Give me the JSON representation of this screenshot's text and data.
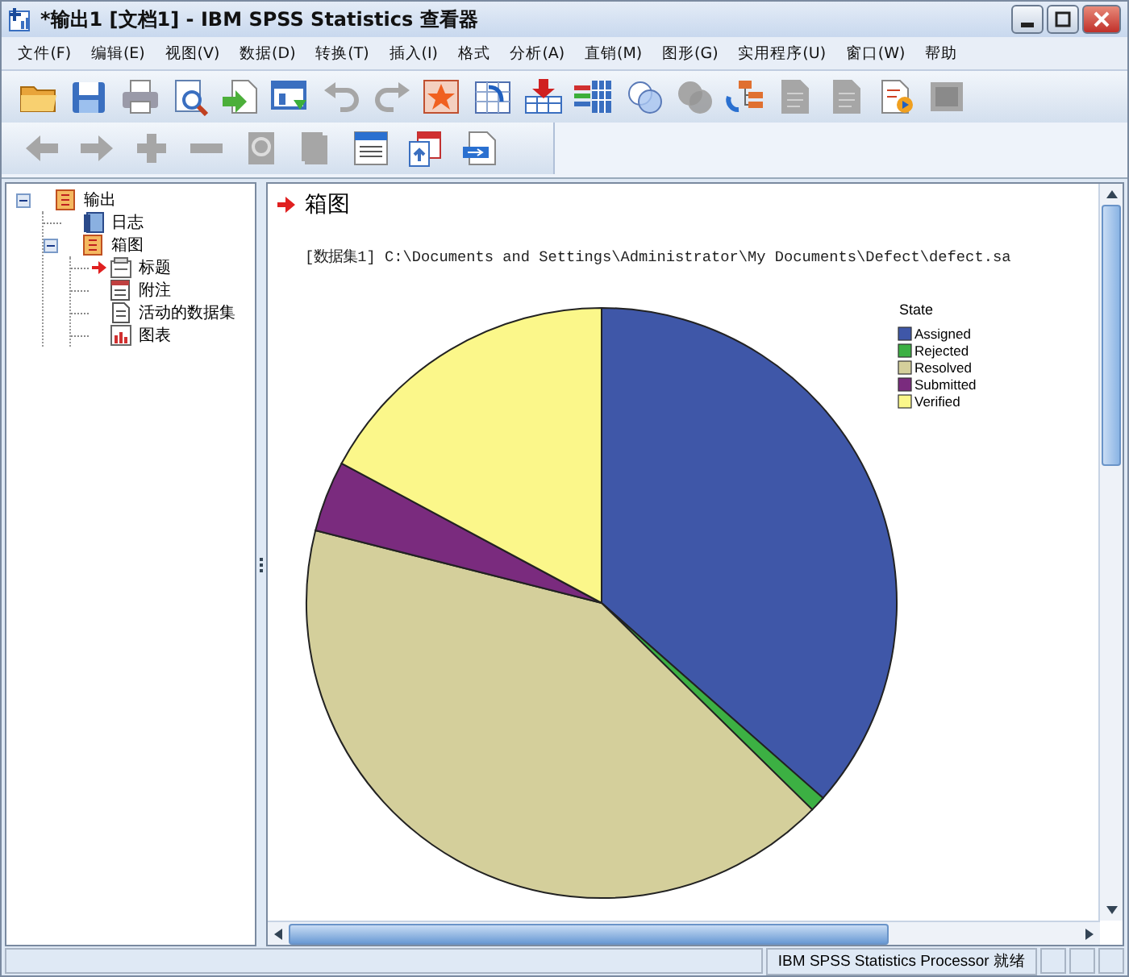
{
  "window": {
    "title": "*输出1 [文档1] - IBM SPSS Statistics 查看器"
  },
  "menu": [
    "文件(F)",
    "编辑(E)",
    "视图(V)",
    "数据(D)",
    "转换(T)",
    "插入(I)",
    "格式",
    "分析(A)",
    "直销(M)",
    "图形(G)",
    "实用程序(U)",
    "窗口(W)",
    "帮助"
  ],
  "toolbar": [
    {
      "kind": "folder",
      "disabled": false
    },
    {
      "kind": "disk",
      "disabled": false
    },
    {
      "kind": "printer",
      "disabled": false
    },
    {
      "kind": "preview",
      "disabled": false
    },
    {
      "kind": "import",
      "disabled": false
    },
    {
      "kind": "window",
      "disabled": false
    },
    {
      "kind": "undo",
      "disabled": true
    },
    {
      "kind": "redo",
      "disabled": true
    },
    {
      "kind": "star",
      "disabled": false
    },
    {
      "kind": "pivot",
      "disabled": false
    },
    {
      "kind": "insert",
      "disabled": false
    },
    {
      "kind": "bars",
      "disabled": false
    },
    {
      "kind": "circles",
      "disabled": false
    },
    {
      "kind": "circles",
      "disabled": true
    },
    {
      "kind": "tree",
      "disabled": false
    },
    {
      "kind": "page",
      "disabled": true
    },
    {
      "kind": "page",
      "disabled": true
    },
    {
      "kind": "script",
      "disabled": false
    },
    {
      "kind": "square",
      "disabled": true
    }
  ],
  "toolbar_2": [
    {
      "kind": "back",
      "disabled": true
    },
    {
      "kind": "forward",
      "disabled": true
    },
    {
      "kind": "plus",
      "disabled": true
    },
    {
      "kind": "minus",
      "disabled": true
    },
    {
      "kind": "zoom",
      "disabled": true
    },
    {
      "kind": "book",
      "disabled": true
    },
    {
      "kind": "heading",
      "disabled": false
    },
    {
      "kind": "copy",
      "disabled": false
    },
    {
      "kind": "export",
      "disabled": false
    }
  ],
  "outline": [
    {
      "label": "输出",
      "kind": "book",
      "expanded": true,
      "selected": false,
      "children": [
        {
          "label": "日志",
          "kind": "log",
          "selected": false
        },
        {
          "label": "箱图",
          "kind": "book",
          "expanded": true,
          "selected": false,
          "children": [
            {
              "label": "标题",
              "kind": "title",
              "selected": true
            },
            {
              "label": "附注",
              "kind": "note",
              "selected": false
            },
            {
              "label": "活动的数据集",
              "kind": "page",
              "selected": false
            },
            {
              "label": "图表",
              "kind": "chart",
              "selected": false
            }
          ]
        }
      ]
    }
  ],
  "output": {
    "heading": "箱图",
    "dataset_line": "[数据集1] C:\\Documents and Settings\\Administrator\\My Documents\\Defect\\defect.sa",
    "legend": {
      "title": "State",
      "items": [
        {
          "label": "Assigned",
          "color": "#3f57a8"
        },
        {
          "label": "Rejected",
          "color": "#3cb043"
        },
        {
          "label": "Resolved",
          "color": "#d4cf9b"
        },
        {
          "label": "Submitted",
          "color": "#7a2b7e"
        },
        {
          "label": "Verified",
          "color": "#fbf78a"
        }
      ]
    }
  },
  "status_bar": {
    "text": "IBM SPSS Statistics Processor 就绪"
  }
}
